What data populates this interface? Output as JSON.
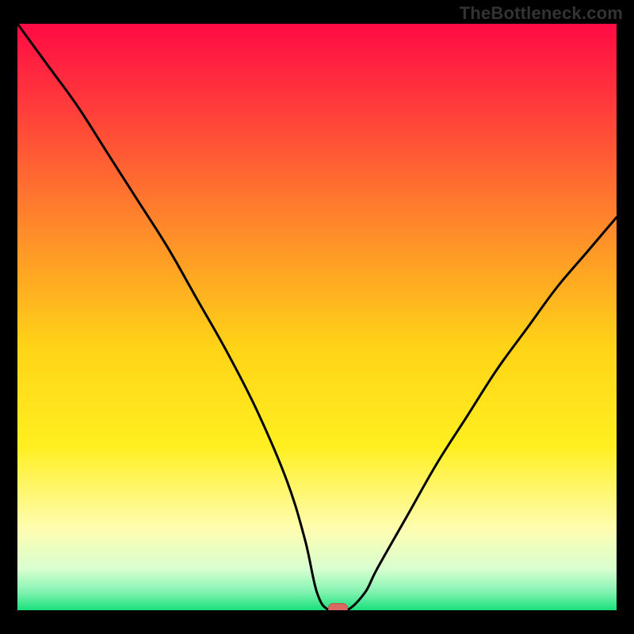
{
  "watermark": "TheBottleneck.com",
  "chart_data": {
    "type": "line",
    "title": "",
    "xlabel": "",
    "ylabel": "",
    "xlim": [
      0,
      100
    ],
    "ylim": [
      0,
      100
    ],
    "grid": false,
    "legend": false,
    "x": [
      0,
      5,
      10,
      15,
      20,
      25,
      30,
      35,
      40,
      45,
      48,
      50,
      52,
      55,
      58,
      60,
      65,
      70,
      75,
      80,
      85,
      90,
      95,
      100
    ],
    "values": [
      100,
      93,
      86,
      78,
      70,
      62,
      53,
      44,
      34,
      22,
      12,
      3,
      0,
      0,
      3,
      7,
      16,
      25,
      33,
      41,
      48,
      55,
      61,
      67
    ],
    "marker": {
      "x": 53.5,
      "y": 0
    },
    "gradient_stops": [
      {
        "offset": 0.0,
        "color": "#ff0a44"
      },
      {
        "offset": 0.15,
        "color": "#ff3f3a"
      },
      {
        "offset": 0.35,
        "color": "#ff8a2a"
      },
      {
        "offset": 0.55,
        "color": "#ffd317"
      },
      {
        "offset": 0.72,
        "color": "#ffef20"
      },
      {
        "offset": 0.86,
        "color": "#fffdb0"
      },
      {
        "offset": 0.93,
        "color": "#d8ffd0"
      },
      {
        "offset": 0.97,
        "color": "#7ff2b0"
      },
      {
        "offset": 1.0,
        "color": "#19e07a"
      }
    ],
    "colors": {
      "curve": "#000000",
      "marker_fill": "#d96a63",
      "marker_stroke": "#c05048",
      "background_frame": "#000000"
    }
  }
}
